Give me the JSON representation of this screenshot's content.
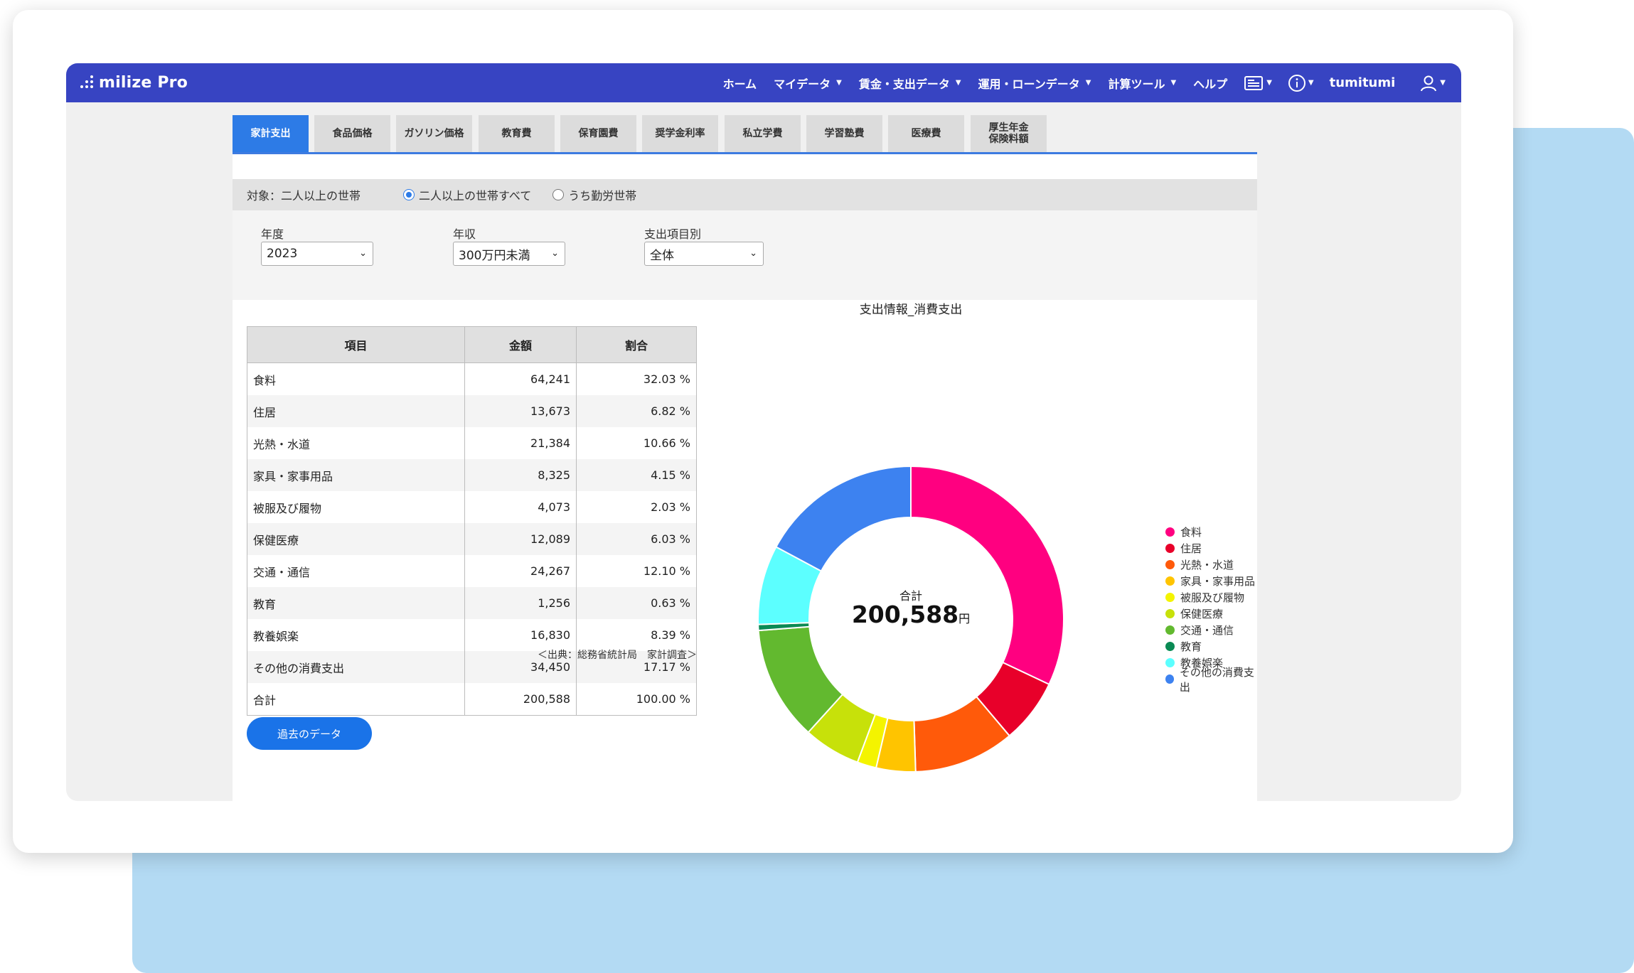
{
  "header": {
    "logo": "milize Pro",
    "nav": [
      {
        "label": "ホーム",
        "caret": false
      },
      {
        "label": "マイデータ",
        "caret": true
      },
      {
        "label": "賃金・支出データ",
        "caret": true
      },
      {
        "label": "運用・ローンデータ",
        "caret": true
      },
      {
        "label": "計算ツール",
        "caret": true
      },
      {
        "label": "ヘルプ",
        "caret": false
      }
    ],
    "user_name": "tumitumi"
  },
  "tabs": [
    "家計支出",
    "食品価格",
    "ガソリン価格",
    "教育費",
    "保育園費",
    "奨学金利率",
    "私立学費",
    "学習塾費",
    "医療費",
    "厚生年金\n保険料額"
  ],
  "active_tab": 0,
  "target": {
    "label": "対象：二人以上の世帯",
    "options": [
      "二人以上の世帯すべて",
      "うち勤労世帯"
    ],
    "selected": 0
  },
  "filters": {
    "year_label": "年度",
    "year_value": "2023",
    "income_label": "年収",
    "income_value": "300万円未満",
    "category_label": "支出項目別",
    "category_value": "全体"
  },
  "table": {
    "headers": [
      "項目",
      "金額",
      "割合"
    ],
    "rows": [
      [
        "食料",
        "64,241",
        "32.03 %"
      ],
      [
        "住居",
        "13,673",
        "6.82 %"
      ],
      [
        "光熱・水道",
        "21,384",
        "10.66 %"
      ],
      [
        "家具・家事用品",
        "8,325",
        "4.15 %"
      ],
      [
        "被服及び履物",
        "4,073",
        "2.03 %"
      ],
      [
        "保健医療",
        "12,089",
        "6.03 %"
      ],
      [
        "交通・通信",
        "24,267",
        "12.10 %"
      ],
      [
        "教育",
        "1,256",
        "0.63 %"
      ],
      [
        "教養娯楽",
        "16,830",
        "8.39 %"
      ],
      [
        "その他の消費支出",
        "34,450",
        "17.17 %"
      ],
      [
        "合計",
        "200,588",
        "100.00 %"
      ]
    ],
    "source": "＜出典：総務省統計局　家計調査＞"
  },
  "past_button": "過去のデータ",
  "chart_data": {
    "type": "pie",
    "title": "支出情報_消費支出",
    "center_label": "合計",
    "center_value": "200,588",
    "center_unit": "円",
    "categories": [
      "食料",
      "住居",
      "光熱・水道",
      "家具・家事用品",
      "被服及び履物",
      "保健医療",
      "交通・通信",
      "教育",
      "教養娯楽",
      "その他の消費支出"
    ],
    "values": [
      64241,
      13673,
      21384,
      8325,
      4073,
      12089,
      24267,
      1256,
      16830,
      34450
    ],
    "colors": [
      "#ff0080",
      "#e8002a",
      "#ff5a0a",
      "#ffc400",
      "#f4f400",
      "#c7e10a",
      "#62b92f",
      "#0a8a54",
      "#5cffff",
      "#3d82f0"
    ],
    "legend_position": "right"
  }
}
